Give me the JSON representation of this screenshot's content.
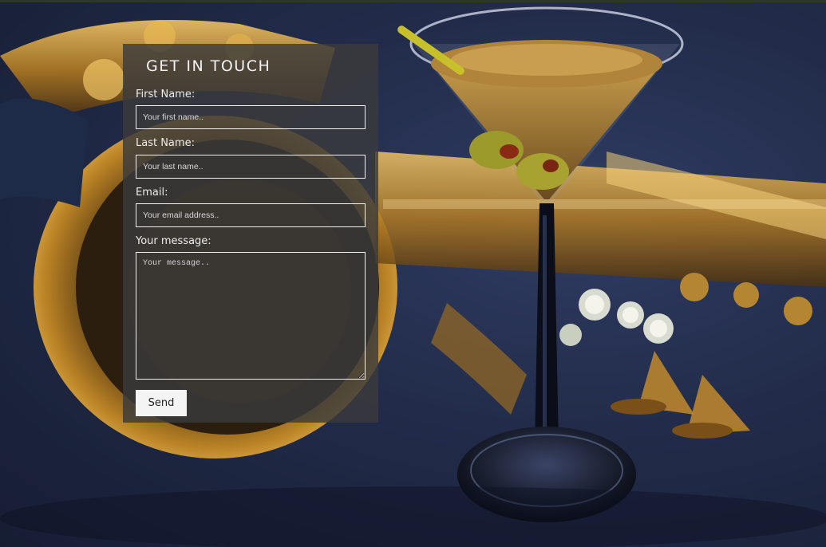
{
  "form": {
    "title": "GET IN TOUCH",
    "first_name": {
      "label": "First Name:",
      "placeholder": "Your first name.."
    },
    "last_name": {
      "label": "Last Name:",
      "placeholder": "Your last name.."
    },
    "email": {
      "label": "Email:",
      "placeholder": "Your email address.."
    },
    "message": {
      "label": "Your message:",
      "placeholder": "Your message.."
    },
    "send_label": "Send"
  },
  "colors": {
    "background": "#222c4a",
    "panel": "#3a3a3c",
    "brass": "#c8912e",
    "field_border": "#f0f0f0"
  },
  "background_image": {
    "icons": [
      "saxophone-illustration",
      "martini-glass-illustration",
      "olive-illustration"
    ]
  }
}
